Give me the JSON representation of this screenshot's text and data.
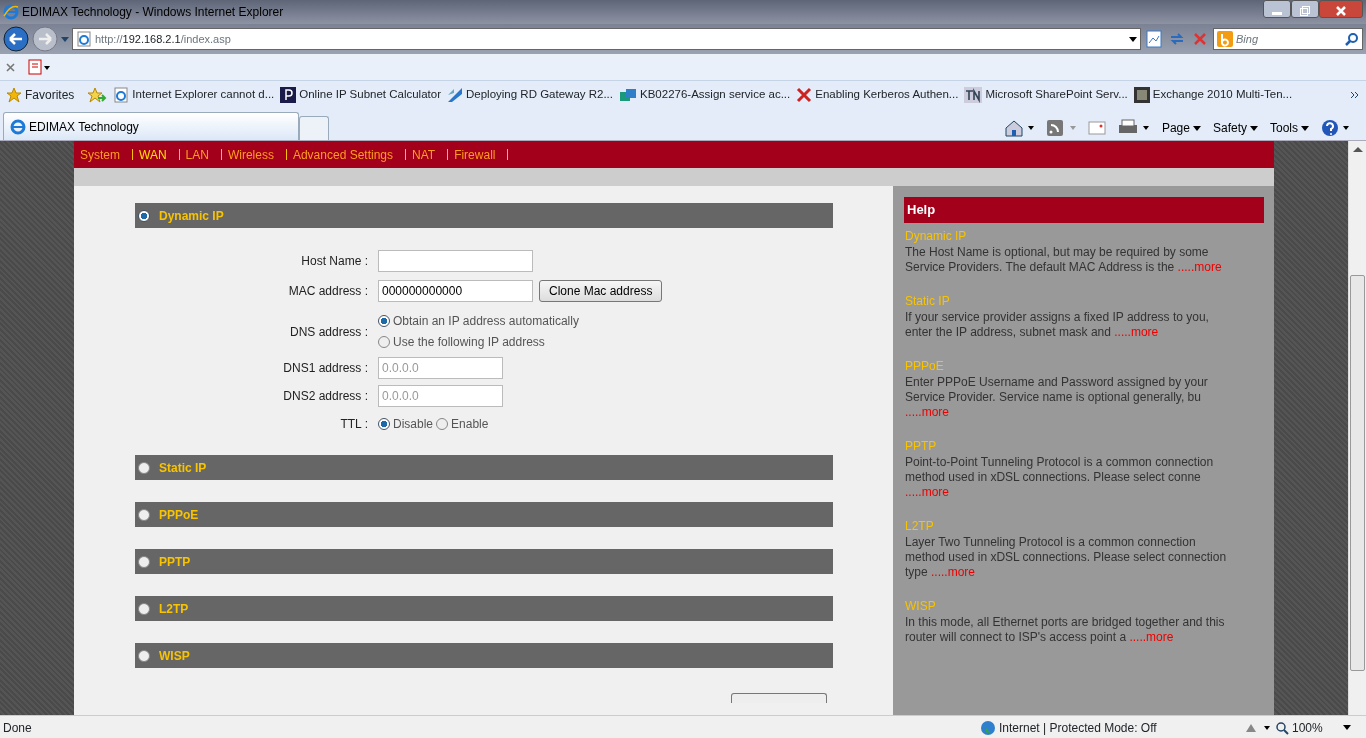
{
  "browser": {
    "title": "EDIMAX Technology - Windows Internet Explorer",
    "url_prefix": "http://",
    "url_host": "192.168.2.1",
    "url_path": "/index.asp",
    "search_placeholder": "Bing",
    "favorites_label": "Favorites",
    "favorites": [
      {
        "label": "Internet Explorer cannot d...",
        "kind": "ie"
      },
      {
        "label": "Online IP Subnet Calculator",
        "kind": "p"
      },
      {
        "label": "Deploying RD Gateway R2...",
        "kind": "wing"
      },
      {
        "label": "KB02276-Assign service ac...",
        "kind": "cube"
      },
      {
        "label": "Enabling Kerberos Authen...",
        "kind": "cross"
      },
      {
        "label": "Microsoft SharePoint Serv...",
        "kind": "tn"
      },
      {
        "label": "Exchange 2010 Multi-Ten...",
        "kind": "dark"
      }
    ],
    "tab_title": "EDIMAX Technology",
    "menus": [
      "Page",
      "Safety",
      "Tools"
    ],
    "status": {
      "text": "Done",
      "zone": "Internet | Protected Mode: Off",
      "zoom": "100%"
    }
  },
  "nav": [
    {
      "label": "System",
      "selected": false
    },
    {
      "label": "WAN",
      "selected": true
    },
    {
      "label": "LAN",
      "selected": false
    },
    {
      "label": "Wireless",
      "selected": false
    },
    {
      "label": "Advanced Settings",
      "selected": false
    },
    {
      "label": "NAT",
      "selected": false
    },
    {
      "label": "Firewall",
      "selected": false
    }
  ],
  "sections": [
    {
      "title": "Dynamic IP",
      "selected": true
    },
    {
      "title": "Static IP",
      "selected": false
    },
    {
      "title": "PPPoE",
      "selected": false
    },
    {
      "title": "PPTP",
      "selected": false
    },
    {
      "title": "L2TP",
      "selected": false
    },
    {
      "title": "WISP",
      "selected": false
    }
  ],
  "form": {
    "host_name_label": "Host Name :",
    "mac_label": "MAC address :",
    "mac_value": "000000000000",
    "clone_button": "Clone Mac address",
    "dns_label": "DNS address :",
    "dns_options": [
      {
        "label": "Obtain an IP address automatically",
        "selected": true
      },
      {
        "label": "Use the following IP address",
        "selected": false
      }
    ],
    "dns1_label": "DNS1 address :",
    "dns1_placeholder": "0.0.0.0",
    "dns2_label": "DNS2 address :",
    "dns2_placeholder": "0.0.0.0",
    "ttl_label": "TTL :",
    "ttl_options": [
      {
        "label": "Disable",
        "selected": true
      },
      {
        "label": "Enable",
        "selected": false
      }
    ]
  },
  "help": {
    "title": "Help",
    "entries": [
      {
        "title": "Dynamic IP",
        "text": "The Host Name is optional, but may be required by some Service Providers. The default MAC Address is the",
        "more": ".....more"
      },
      {
        "title": "Static IP",
        "text": "If your service provider assigns a fixed IP address to you, enter the IP address, subnet mask and",
        "more": ".....more"
      },
      {
        "title": "PPPoE",
        "text": "Enter PPPoE Username and Password assigned by your Service Provider. Service name is optional generally, bu",
        "more": ".....more"
      },
      {
        "title": "PPTP",
        "text": "Point-to-Point Tunneling Protocol is a common connection method used in xDSL connections. Please select conne",
        "more": ".....more"
      },
      {
        "title": "L2TP",
        "text": "Layer Two Tunneling Protocol is a common connection method used in xDSL connections. Please select connection type",
        "more": ".....more"
      },
      {
        "title": "WISP",
        "text": "In this mode, all Ethernet ports are bridged together and this router will connect to ISP's access point a",
        "more": ".....more"
      }
    ]
  }
}
